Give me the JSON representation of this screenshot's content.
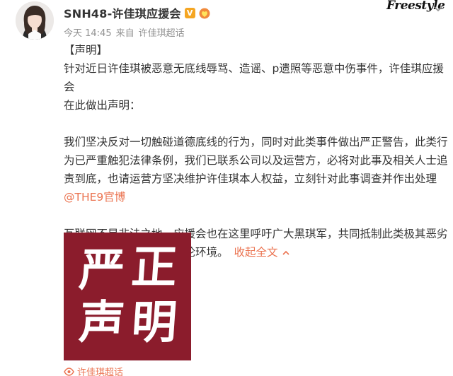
{
  "header": {
    "name": "SNH48-许佳琪应援会",
    "v_badge": "V",
    "brand_logo": "Freestyle",
    "meta": {
      "time": "今天 14:45",
      "via": "来自",
      "source": "许佳琪超话"
    }
  },
  "post": {
    "heading": "【声明】",
    "line1": "针对近日许佳琪被恶意无底线辱骂、造谣、p遗照等恶意中伤事件，许佳琪应援会",
    "line2": "在此做出声明：",
    "para2_l1": "我们坚决反对一切触碰道德底线的行为，同时对此类事件做出严正警告，此类行",
    "para2_l2": "为已严重触犯法律条例，我们已联系公司以及运营方，必将对此事及相关人士追",
    "para2_l3": "责到底，也请运营方坚决维护许佳琪本人权益，立刻针对此事调查并作出处理",
    "mention": "@THE9官博",
    "para3_l1": "互联网不是非法之地，应援会也在这里呼吁广大黑琪军，共同抵制此类极其恶劣",
    "para3_l2": "的行为，共同维护公共舆论环境。",
    "collapse": "收起全文"
  },
  "image": {
    "chars": [
      "严",
      "正",
      "声",
      "明"
    ],
    "bg_color": "#8b1c2c"
  },
  "footer": {
    "supertopic": "许佳琪超话"
  },
  "colors": {
    "link": "#eb7350",
    "meta": "#939393",
    "vip": "#f5a623"
  }
}
